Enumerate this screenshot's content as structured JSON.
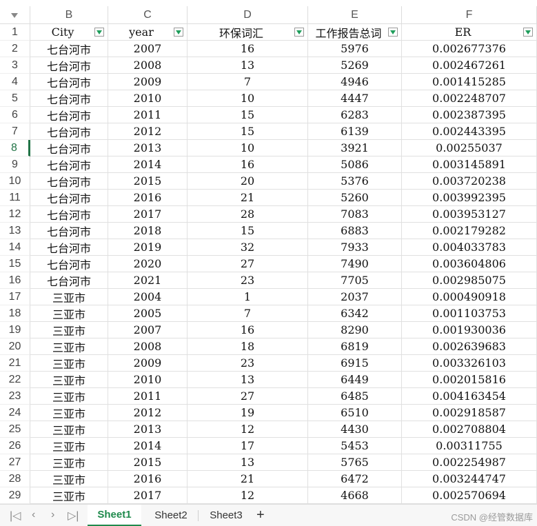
{
  "columns": [
    {
      "letter": "B",
      "header": "City"
    },
    {
      "letter": "C",
      "header": "year"
    },
    {
      "letter": "D",
      "header": "环保词汇"
    },
    {
      "letter": "E",
      "header": "工作报告总词"
    },
    {
      "letter": "F",
      "header": "ER"
    }
  ],
  "header_row_number": "1",
  "active_row": "8",
  "rows": [
    {
      "n": "2",
      "city": "七台河市",
      "year": "2007",
      "d": "16",
      "e": "5976",
      "er": "0.002677376"
    },
    {
      "n": "3",
      "city": "七台河市",
      "year": "2008",
      "d": "13",
      "e": "5269",
      "er": "0.002467261"
    },
    {
      "n": "4",
      "city": "七台河市",
      "year": "2009",
      "d": "7",
      "e": "4946",
      "er": "0.001415285"
    },
    {
      "n": "5",
      "city": "七台河市",
      "year": "2010",
      "d": "10",
      "e": "4447",
      "er": "0.002248707"
    },
    {
      "n": "6",
      "city": "七台河市",
      "year": "2011",
      "d": "15",
      "e": "6283",
      "er": "0.002387395"
    },
    {
      "n": "7",
      "city": "七台河市",
      "year": "2012",
      "d": "15",
      "e": "6139",
      "er": "0.002443395"
    },
    {
      "n": "8",
      "city": "七台河市",
      "year": "2013",
      "d": "10",
      "e": "3921",
      "er": "0.00255037"
    },
    {
      "n": "9",
      "city": "七台河市",
      "year": "2014",
      "d": "16",
      "e": "5086",
      "er": "0.003145891"
    },
    {
      "n": "10",
      "city": "七台河市",
      "year": "2015",
      "d": "20",
      "e": "5376",
      "er": "0.003720238"
    },
    {
      "n": "11",
      "city": "七台河市",
      "year": "2016",
      "d": "21",
      "e": "5260",
      "er": "0.003992395"
    },
    {
      "n": "12",
      "city": "七台河市",
      "year": "2017",
      "d": "28",
      "e": "7083",
      "er": "0.003953127"
    },
    {
      "n": "13",
      "city": "七台河市",
      "year": "2018",
      "d": "15",
      "e": "6883",
      "er": "0.002179282"
    },
    {
      "n": "14",
      "city": "七台河市",
      "year": "2019",
      "d": "32",
      "e": "7933",
      "er": "0.004033783"
    },
    {
      "n": "15",
      "city": "七台河市",
      "year": "2020",
      "d": "27",
      "e": "7490",
      "er": "0.003604806"
    },
    {
      "n": "16",
      "city": "七台河市",
      "year": "2021",
      "d": "23",
      "e": "7705",
      "er": "0.002985075"
    },
    {
      "n": "17",
      "city": "三亚市",
      "year": "2004",
      "d": "1",
      "e": "2037",
      "er": "0.000490918"
    },
    {
      "n": "18",
      "city": "三亚市",
      "year": "2005",
      "d": "7",
      "e": "6342",
      "er": "0.001103753"
    },
    {
      "n": "19",
      "city": "三亚市",
      "year": "2007",
      "d": "16",
      "e": "8290",
      "er": "0.001930036"
    },
    {
      "n": "20",
      "city": "三亚市",
      "year": "2008",
      "d": "18",
      "e": "6819",
      "er": "0.002639683"
    },
    {
      "n": "21",
      "city": "三亚市",
      "year": "2009",
      "d": "23",
      "e": "6915",
      "er": "0.003326103"
    },
    {
      "n": "22",
      "city": "三亚市",
      "year": "2010",
      "d": "13",
      "e": "6449",
      "er": "0.002015816"
    },
    {
      "n": "23",
      "city": "三亚市",
      "year": "2011",
      "d": "27",
      "e": "6485",
      "er": "0.004163454"
    },
    {
      "n": "24",
      "city": "三亚市",
      "year": "2012",
      "d": "19",
      "e": "6510",
      "er": "0.002918587"
    },
    {
      "n": "25",
      "city": "三亚市",
      "year": "2013",
      "d": "12",
      "e": "4430",
      "er": "0.002708804"
    },
    {
      "n": "26",
      "city": "三亚市",
      "year": "2014",
      "d": "17",
      "e": "5453",
      "er": "0.00311755"
    },
    {
      "n": "27",
      "city": "三亚市",
      "year": "2015",
      "d": "13",
      "e": "5765",
      "er": "0.002254987"
    },
    {
      "n": "28",
      "city": "三亚市",
      "year": "2016",
      "d": "21",
      "e": "6472",
      "er": "0.003244747"
    },
    {
      "n": "29",
      "city": "三亚市",
      "year": "2017",
      "d": "12",
      "e": "4668",
      "er": "0.002570694"
    }
  ],
  "tabs": [
    {
      "label": "Sheet1",
      "active": true
    },
    {
      "label": "Sheet2",
      "active": false
    },
    {
      "label": "Sheet3",
      "active": false
    }
  ],
  "add_tab": "+",
  "nav": {
    "first": "|◁",
    "prev": "‹",
    "next": "›",
    "last": "▷|"
  },
  "watermark": "CSDN @经管数据库",
  "colors": {
    "accent": "#217346",
    "filter_arrow": "#1f9e5c",
    "grid": "#e0e0e0"
  }
}
